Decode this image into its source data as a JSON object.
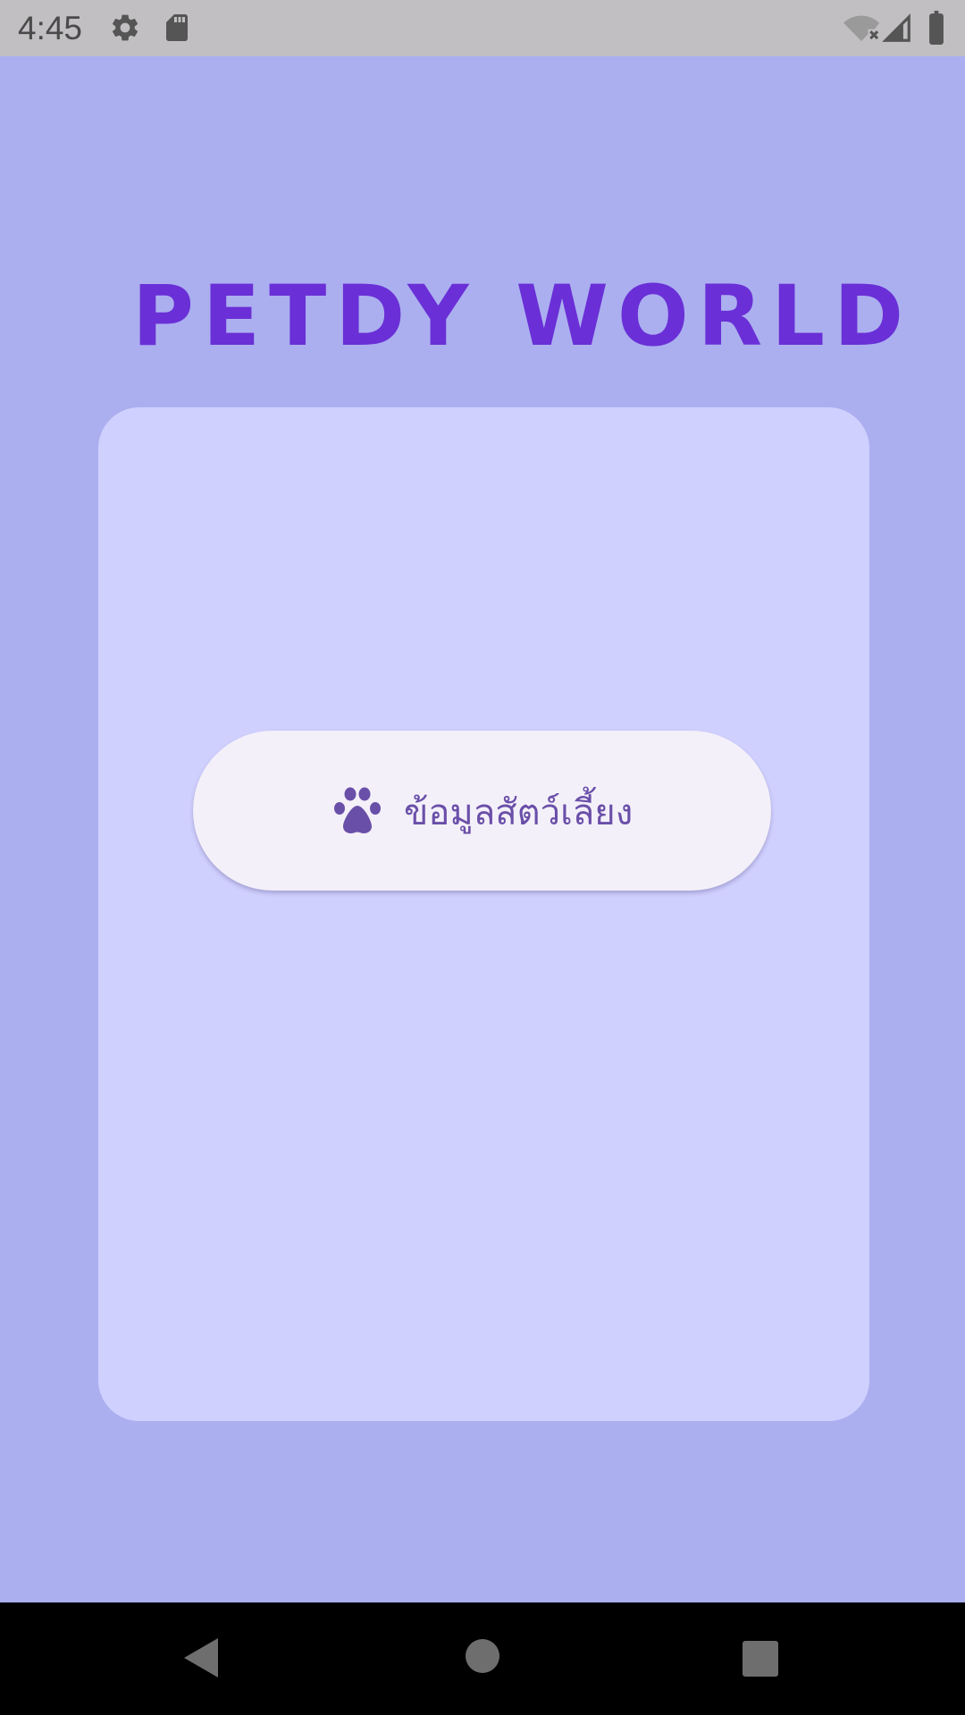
{
  "status_bar": {
    "time": "4:45",
    "icons": [
      "settings-icon",
      "sd-card-icon",
      "wifi-off-icon",
      "cell-signal-icon",
      "battery-icon"
    ]
  },
  "app": {
    "title": "PETDY WORLD",
    "title_color": "#6a2fd6",
    "background_color": "#abaff0",
    "card_color": "#d0d0fe"
  },
  "pet_button": {
    "icon": "paw-icon",
    "label": "ข้อมูลสัตว์เลี้ยง",
    "text_color": "#6a4fa9"
  },
  "nav_bar": {
    "buttons": [
      "back-icon",
      "home-icon",
      "recents-icon"
    ]
  }
}
